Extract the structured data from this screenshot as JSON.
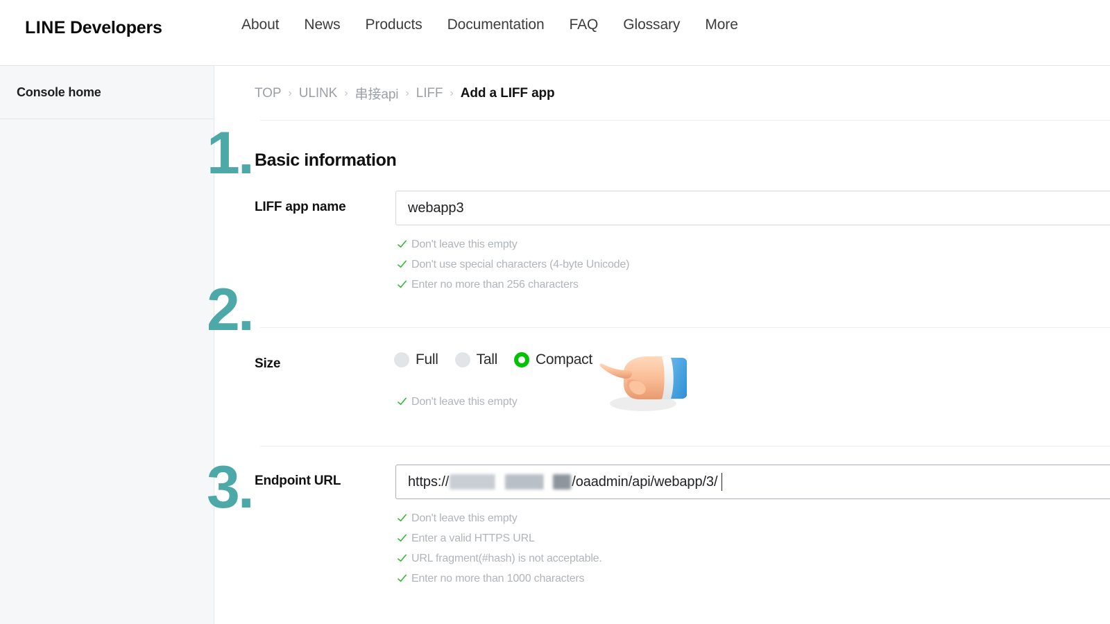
{
  "header": {
    "logo_primary": "LINE",
    "logo_secondary": "Developers",
    "nav": [
      {
        "label": "About"
      },
      {
        "label": "News"
      },
      {
        "label": "Products"
      },
      {
        "label": "Documentation"
      },
      {
        "label": "FAQ"
      },
      {
        "label": "Glossary"
      },
      {
        "label": "More"
      }
    ]
  },
  "sidebar": {
    "console_home": "Console home"
  },
  "breadcrumb": {
    "separator": "›",
    "items": [
      {
        "label": "TOP"
      },
      {
        "label": "ULINK"
      },
      {
        "label": "串接api"
      },
      {
        "label": "LIFF"
      },
      {
        "label": "Add a LIFF app"
      }
    ]
  },
  "steps": {
    "one": "1.",
    "two": "2.",
    "three": "3."
  },
  "section": {
    "basic_information": "Basic information"
  },
  "fields": {
    "app_name": {
      "label": "LIFF app name",
      "value": "webapp3",
      "placeholder": "",
      "validations": [
        "Don't leave this empty",
        "Don't use special characters (4-byte Unicode)",
        "Enter no more than 256 characters"
      ]
    },
    "size": {
      "label": "Size",
      "options": [
        {
          "label": "Full",
          "selected": false
        },
        {
          "label": "Tall",
          "selected": false
        },
        {
          "label": "Compact",
          "selected": true
        }
      ],
      "selected_value": "Compact",
      "validations": [
        "Don't leave this empty"
      ]
    },
    "endpoint_url": {
      "label": "Endpoint URL",
      "value_prefix": "https://",
      "value_suffix": "/oaadmin/api/webapp/3/",
      "value_redacted": true,
      "validations": [
        "Don't leave this empty",
        "Enter a valid HTTPS URL",
        "URL fragment(#hash) is not acceptable.",
        "Enter no more than 1000 characters"
      ]
    }
  },
  "colors": {
    "step_teal": "#4da8a8",
    "radio_selected_green": "#00c300",
    "check_green": "#35b835",
    "validation_text": "#b0b5ba",
    "sidebar_bg": "#f6f7f8"
  },
  "icons": {
    "check": "check-icon",
    "pointing_hand": "pointing-hand-left-icon",
    "chevron": "chevron-right-icon"
  }
}
